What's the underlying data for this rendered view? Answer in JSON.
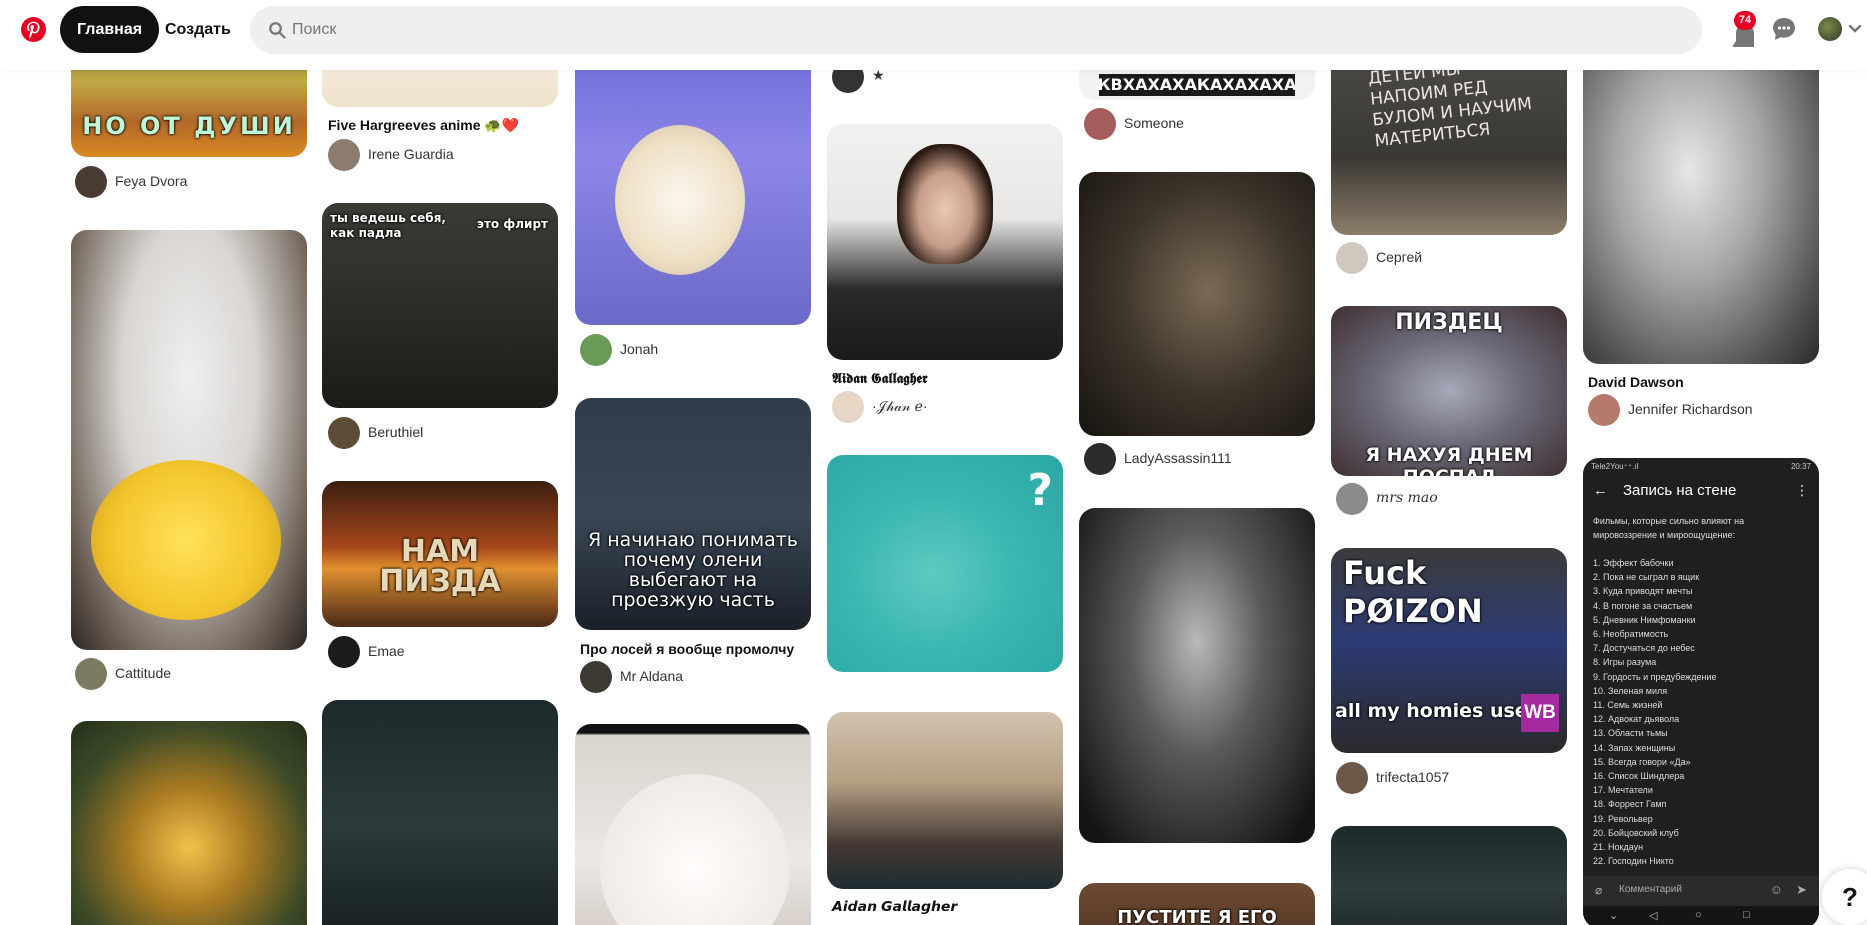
{
  "header": {
    "home_label": "Главная",
    "create_label": "Создать",
    "search_placeholder": "Поиск",
    "notifications_count": "74"
  },
  "pins": {
    "p1": {
      "caption": "НО ОТ ДУШИ",
      "user": "Feya Dvora"
    },
    "p2": {
      "user": "Cattitude"
    },
    "p3": {
      "user": ""
    },
    "p4": {
      "title": "Five Hargreeves anime 🐢❤️",
      "user": "Irene Guardia"
    },
    "p5": {
      "caption_left": "ты ведешь себя,\nкак падла",
      "caption_right": "это флирт",
      "user": "Beruthiel"
    },
    "p6": {
      "caption": "НАМ\nПИЗДА",
      "user": "Emae"
    },
    "p7": {
      "user": ""
    },
    "p8": {
      "user": "Jonah"
    },
    "p9": {
      "caption": "Я начинаю понимать почему олени выбегают на проезжую часть",
      "title": "Про лосей я вообще промолчу",
      "user": "Mr Aldana"
    },
    "p10": {
      "user": ""
    },
    "p11": {
      "user": "★"
    },
    "p12": {
      "title": "𝕬𝖎𝖉𝖆𝖓 𝕲𝖆𝖑𝖑𝖆𝖌𝖍𝖊𝖗",
      "user": "·𝒥𝒽𝒶𝓃 ℯ·"
    },
    "p13": {
      "caption": "?"
    },
    "p14": {
      "title": "𝘼𝙞𝙙𝙖𝙣 𝙂𝙖𝙡𝙡𝙖𝙜𝙝𝙚𝙧"
    },
    "p15": {
      "caption": "КВХАХАХАКАХАХАХА",
      "user": "Someone"
    },
    "p16": {
      "user": "LadyAssassin111"
    },
    "p17": {
      "user": ""
    },
    "p18": {
      "caption": "ПУСТИТЕ Я ЕГО"
    },
    "p19": {
      "caption": "ДЕТЕЙ МЫ НАПОИМ РЕД БУЛОМ И НАУЧИМ МАТЕРИТЬСЯ",
      "user": "Сергей"
    },
    "p20": {
      "caption_top": "ПИЗДЕЦ",
      "caption_bottom": "Я НАХУЯ ДНЕМ ПОСПАЛ",
      "user": "mrs mao"
    },
    "p21": {
      "caption_top": "Fuck PØIZON",
      "caption_bottom": "all my homies use",
      "brand": "WB",
      "user": "trifecta1057"
    },
    "p22": {
      "title": "David Dawson",
      "user": "Jennifer Richardson"
    },
    "p23": {
      "status_left": "Tele2You⁺⁺.ıl",
      "status_right": "20:37",
      "title": "Запись на стене",
      "intro": "Фильмы, которые сильно влияют на мировоззрение и мироощущение:",
      "list": [
        "1. Эффект бабочки",
        "2. Пока не сыграл в ящик",
        "3. Куда приводят мечты",
        "4. В погоне за счастьем",
        "5. Дневник Нимфоманки",
        "6. Необратимость",
        "7. Достучаться до небес",
        "8. Игры разума",
        "9. Гордость и предубеждение",
        "10. Зеленая миля",
        "11. Семь жизней",
        "12. Адвокат дьявола",
        "13. Области тьмы",
        "14. Запах женщины",
        "15. Всегда говори «Да»",
        "16. Список Шиндлера",
        "17. Мечтатели",
        "18. Форрест Гамп",
        "19. Револьвер",
        "20. Бойцовский клуб",
        "21. Нокдаун",
        "22. Господин Никто"
      ],
      "comment_placeholder": "Комментарий"
    }
  },
  "help_label": "?"
}
